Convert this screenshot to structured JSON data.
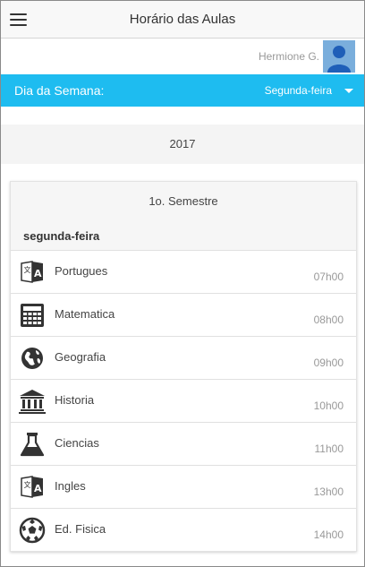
{
  "header": {
    "title": "Horário das Aulas",
    "menu_icon": "hamburger-menu-icon"
  },
  "user": {
    "name": "Hermione G.",
    "avatar_icon": "user-avatar-icon",
    "avatar_color": "#7aaedc"
  },
  "day_filter": {
    "label": "Dia da Semana:",
    "selected": "Segunda-feira",
    "bar_color": "#1ebcf0"
  },
  "year": "2017",
  "schedule": {
    "semester": "1o. Semestre",
    "day": "segunda-feira",
    "classes": [
      {
        "subject": "Portugues",
        "time": "07h00",
        "icon": "translate-book-icon"
      },
      {
        "subject": "Matematica",
        "time": "08h00",
        "icon": "calculator-icon"
      },
      {
        "subject": "Geografia",
        "time": "09h00",
        "icon": "globe-icon"
      },
      {
        "subject": "Historia",
        "time": "10h00",
        "icon": "museum-columns-icon"
      },
      {
        "subject": "Ciencias",
        "time": "11h00",
        "icon": "flask-icon"
      },
      {
        "subject": "Ingles",
        "time": "13h00",
        "icon": "translate-book-icon"
      },
      {
        "subject": "Ed. Fisica",
        "time": "14h00",
        "icon": "soccer-ball-icon"
      }
    ]
  }
}
